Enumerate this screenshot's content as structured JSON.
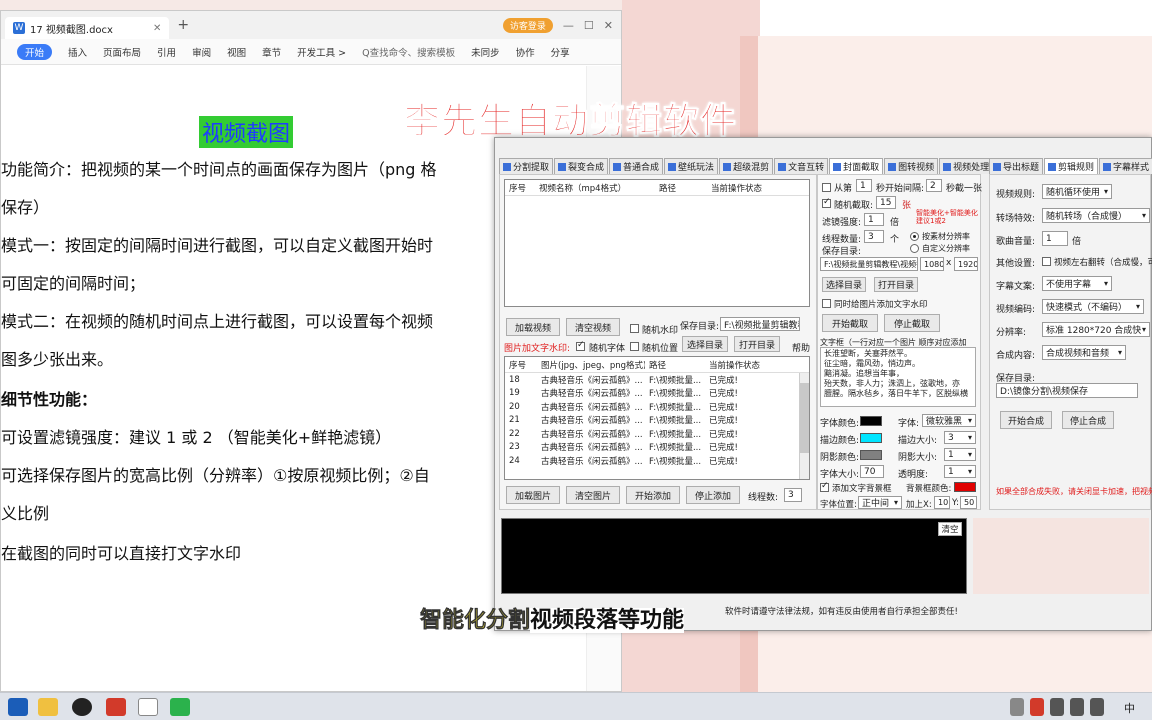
{
  "captions": {
    "top": "李先生自动剪辑软件",
    "bottom_yellow": "智能化分割",
    "bottom_white": "视频段落等功能"
  },
  "word": {
    "tab_title": "17 视频截图.docx",
    "visitor_btn": "访客登录",
    "ribbon": [
      "开始",
      "插入",
      "页面布局",
      "引用",
      "审阅",
      "视图",
      "章节",
      "开发工具 >"
    ],
    "search_placeholder": "Q查找命令、搜索模板",
    "right_actions": [
      "未同步",
      "协作",
      "分享"
    ],
    "doc_title": "视频截图",
    "paragraphs": [
      "功能简介：把视频的某一个时间点的画面保存为图片（png 格",
      "保存）",
      "模式一：按固定的间隔时间进行截图，可以自定义截图开始时",
      "可固定的间隔时间；",
      "模式二：在视频的随机时间点上进行截图，可以设置每个视频",
      "图多少张出来。",
      "细节性功能：",
      "可设置滤镜强度：建议 1 或 2  （智能美化+鲜艳滤镜）",
      "可选择保存图片的宽高比例（分辨率）①按原视频比例；②自",
      "义比例",
      "在截图的同时可以直接打文字水印"
    ]
  },
  "app": {
    "left_tabs": [
      "分割提取",
      "裂变合成",
      "普通合成",
      "壁纸玩法",
      "超级混剪",
      "文音互转",
      "封面截取",
      "图转视频",
      "视频处理"
    ],
    "right_tabs": [
      "导出标题",
      "剪辑规则",
      "字幕样式"
    ],
    "video_grid": {
      "headers": [
        "序号",
        "视频名称（mp4格式）",
        "路径",
        "当前操作状态"
      ]
    },
    "btn_load_video": "加载视频",
    "btn_clear_video": "清空视频",
    "chk_random_watermark": "随机水印",
    "save_dir_label": "保存目录:",
    "save_dir_value": "F:\\视频批量剪辑教程\\",
    "img_watermark_label": "图片加文字水印:",
    "chk_random_font": "随机字体",
    "chk_random_pos": "随机位置",
    "btn_choose_dir": "选择目录",
    "btn_open_dir": "打开目录",
    "help": "帮助",
    "img_grid": {
      "headers": [
        "序号",
        "图片(jpg、jpeg、png格式)",
        "路径",
        "当前操作状态"
      ],
      "rows": [
        [
          "18",
          "古典轻音乐《闲云孤鹤》...",
          "F:\\视频批量...",
          "已完成!"
        ],
        [
          "19",
          "古典轻音乐《闲云孤鹤》...",
          "F:\\视频批量...",
          "已完成!"
        ],
        [
          "20",
          "古典轻音乐《闲云孤鹤》...",
          "F:\\视频批量...",
          "已完成!"
        ],
        [
          "21",
          "古典轻音乐《闲云孤鹤》...",
          "F:\\视频批量...",
          "已完成!"
        ],
        [
          "22",
          "古典轻音乐《闲云孤鹤》...",
          "F:\\视频批量...",
          "已完成!"
        ],
        [
          "23",
          "古典轻音乐《闲云孤鹤》...",
          "F:\\视频批量...",
          "已完成!"
        ],
        [
          "24",
          "古典轻音乐《闲云孤鹤》...",
          "F:\\视频批量...",
          "已完成!"
        ]
      ]
    },
    "btn_load_img": "加载图片",
    "btn_clear_img": "清空图片",
    "btn_start_add": "开始添加",
    "btn_stop_add": "停止添加",
    "threads_label": "线程数:",
    "threads_value": "3",
    "cover": {
      "from_label": "从第",
      "from_value": "1",
      "sec_start_interval": "秒开始间隔:",
      "interval_value": "2",
      "per_sec": "秒截一张",
      "random_label": "随机截取:",
      "random_value": "15",
      "zhang": "张",
      "hint": "智能美化+智能美化 建议1或2",
      "filter_label": "滤镜强度:",
      "filter_value": "1",
      "bei": "倍",
      "threads_label": "线程数量:",
      "threads_value": "3",
      "ge": "个",
      "ratio_orig": "按素材分辨率",
      "ratio_custom": "自定义分辨率",
      "save_label": "保存目录:",
      "save_value": "F:\\视频批量剪辑教程\\视频截",
      "w": "1080",
      "x": "x",
      "h": "1920",
      "btn_choose": "选择目录",
      "btn_open": "打开目录",
      "chk_add_text": "同时给图片添加文字水印",
      "btn_start": "开始截取",
      "btn_stop": "停止截取",
      "text_box_label": "文字框（一行对应一个图片 顺序对应添加",
      "text_lines": [
        "长淮望断，关塞莽然平。",
        "征尘暗，霜风劲，悄边声。",
        "黯消凝。追想当年事，",
        "殆天数，非人力；洙泗上，弦歌地，亦",
        "膻腥。隔水毡乡，落日牛羊下，区脱纵横"
      ],
      "font_color": "字体颜色:",
      "font": "字体:",
      "font_value": "微软雅黑",
      "stroke_color": "描边颜色:",
      "stroke_size": "描边大小:",
      "stroke_size_value": "3",
      "shadow_color": "阴影颜色:",
      "shadow_size": "阴影大小:",
      "shadow_size_value": "1",
      "font_size": "字体大小:",
      "font_size_value": "70",
      "opacity": "透明度:",
      "opacity_value": "1",
      "chk_bg": "添加文字背景框",
      "bg_color": "背景框颜色:",
      "font_pos": "字体位置:",
      "font_pos_value": "正中间",
      "add_up": "加上X:",
      "add_x": "10",
      "y": "Y:",
      "add_y": "50",
      "colors": {
        "font": "#000000",
        "stroke": "#00e5ff",
        "shadow": "#808080",
        "bg": "#e00000"
      }
    },
    "console_clear": "清空",
    "notice": "软件时请遵守法律法规，如有违反由使用者自行承担全部责任!",
    "rules": {
      "video_rule_label": "视频规则:",
      "video_rule_value": "随机循环使用",
      "transition_label": "转场特效:",
      "transition_value": "随机转场（合成慢）",
      "song_vol_label": "歌曲音量:",
      "song_vol_value": "1",
      "bei": "倍",
      "other_label": "其他设置:",
      "other_value": "视频左右翻转（合成慢，可以",
      "subtitle_label": "字幕文案:",
      "subtitle_value": "不使用字幕",
      "encode_label": "视频编码:",
      "encode_value": "快速模式（不编码）",
      "res_label": "分辨率:",
      "res_value": "标准 1280*720 合成快",
      "content_label": "合成内容:",
      "content_value": "合成视频和音频",
      "save_label": "保存目录:",
      "save_value": "D:\\镜像分割\\视频保存",
      "btn_start": "开始合成",
      "btn_stop": "停止合成",
      "warning": "如果全部合成失败，请关闭显卡加速，把视频"
    }
  },
  "taskbar": {
    "tray_text": "中"
  }
}
